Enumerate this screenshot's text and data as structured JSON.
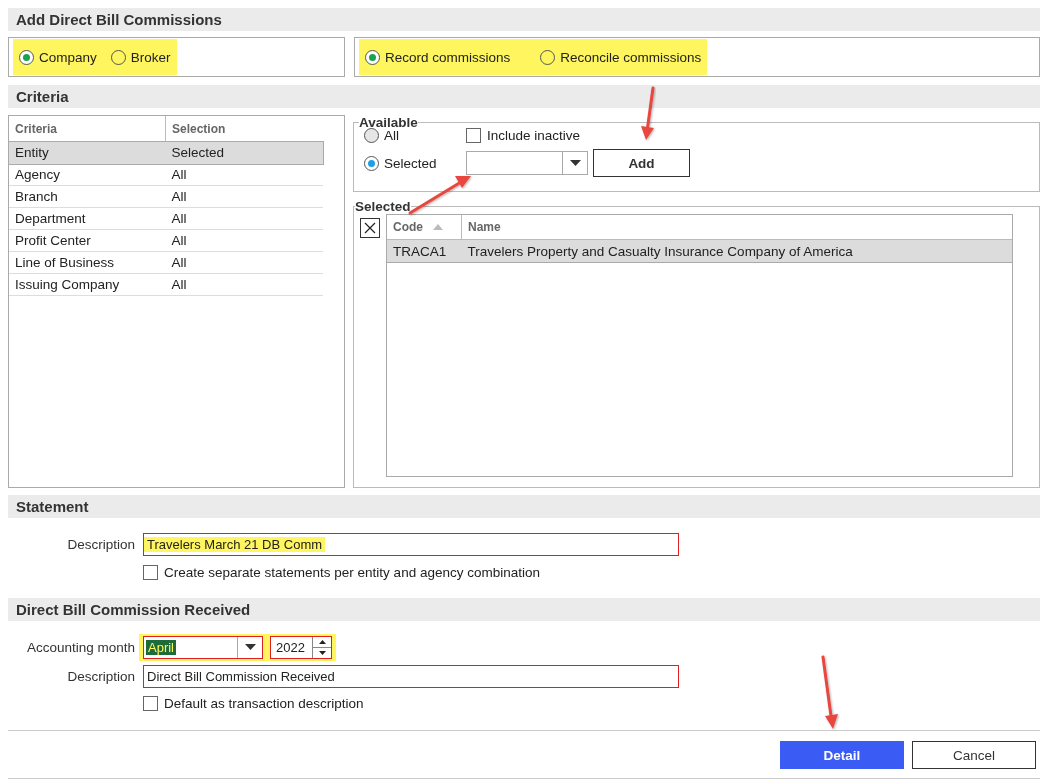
{
  "title": "Add Direct Bill Commissions",
  "party_type": {
    "highlighted": true,
    "options": [
      {
        "label": "Company",
        "selected": true
      },
      {
        "label": "Broker",
        "selected": false
      }
    ]
  },
  "mode": {
    "highlighted": true,
    "options": [
      {
        "label": "Record commissions",
        "selected": true
      },
      {
        "label": "Reconcile commissions",
        "selected": false
      }
    ]
  },
  "criteria": {
    "header": "Criteria",
    "columns": [
      "Criteria",
      "Selection"
    ],
    "rows": [
      {
        "criteria": "Entity",
        "selection": "Selected",
        "selected": true
      },
      {
        "criteria": "Agency",
        "selection": "All",
        "selected": false
      },
      {
        "criteria": "Branch",
        "selection": "All",
        "selected": false
      },
      {
        "criteria": "Department",
        "selection": "All",
        "selected": false
      },
      {
        "criteria": "Profit Center",
        "selection": "All",
        "selected": false
      },
      {
        "criteria": "Line of Business",
        "selection": "All",
        "selected": false
      },
      {
        "criteria": "Issuing Company",
        "selection": "All",
        "selected": false
      }
    ]
  },
  "available": {
    "legend": "Available",
    "options": [
      {
        "label": "All",
        "selected": false
      },
      {
        "label": "Selected",
        "selected": true
      }
    ],
    "include_inactive": {
      "label": "Include inactive",
      "checked": false
    },
    "add_button": "Add"
  },
  "selected": {
    "legend": "Selected",
    "columns": [
      {
        "label": "Code",
        "sorted": true
      },
      {
        "label": "Name",
        "sorted": false
      }
    ],
    "rows": [
      {
        "code": "TRACA1",
        "name": "Travelers Property and Casualty Insurance Company of America",
        "selected": true
      }
    ]
  },
  "statement": {
    "header": "Statement",
    "description": {
      "label": "Description",
      "value": "Travelers March 21 DB Comm",
      "flagged": true,
      "highlighted": true
    },
    "separate": {
      "label": "Create separate statements per entity and agency combination",
      "checked": false
    }
  },
  "received": {
    "header": "Direct Bill Commission Received",
    "accounting_month": {
      "label": "Accounting month",
      "month": "April",
      "month_text_selected": true,
      "year": "2022",
      "flagged": true,
      "highlighted": true
    },
    "description": {
      "label": "Description",
      "value": "Direct Bill Commission Received",
      "flagged": true,
      "highlighted": false
    },
    "default_desc": {
      "label": "Default as transaction description",
      "checked": false
    }
  },
  "buttons": [
    {
      "label": "Detail",
      "kind": "primary"
    },
    {
      "label": "Cancel",
      "kind": "secondary"
    }
  ]
}
